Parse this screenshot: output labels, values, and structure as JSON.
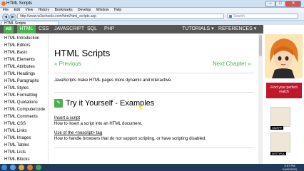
{
  "window": {
    "title": "HTML Scripts",
    "minimize": "–",
    "maximize": "□",
    "close": "✕"
  },
  "menu": [
    "File",
    "Edit",
    "View",
    "History",
    "Bookmarks",
    "Develop",
    "Window",
    "Help"
  ],
  "browser": {
    "back": "◀",
    "forward": "▶",
    "url": "http://www.w3schools.com/html/html_scripts.asp",
    "search_placeholder": "Search",
    "tab_title": "HTML Scripts"
  },
  "site_nav": {
    "logo": "w3",
    "items": [
      "HTML",
      "CSS",
      "JAVASCRIPT",
      "SQL",
      "PHP"
    ],
    "tutorials": "TUTORIALS ▾",
    "references": "REFERENCES ▾"
  },
  "sidebar": {
    "items": [
      "HTML Introduction",
      "HTML Editors",
      "HTML Basic",
      "HTML Elements",
      "HTML Attributes",
      "HTML Headings",
      "HTML Paragraphs",
      "HTML Styles",
      "HTML Formatting",
      "HTML Quotations",
      "HTML Computercode",
      "HTML Comments",
      "HTML CSS",
      "HTML Links",
      "HTML Images",
      "HTML Tables",
      "HTML Lists",
      "HTML Blocks"
    ]
  },
  "main": {
    "title": "HTML Scripts",
    "previous": "« Previous",
    "next": "Next Chapter »",
    "intro": "JavaScripts make HTML pages more dynamic and interactive.",
    "try_heading": "Try it Yourself - Examples",
    "examples": [
      {
        "link": "Insert a script",
        "desc": "How to insert a script into an HTML document."
      },
      {
        "link": "Use of the <noscript> tag",
        "desc": "How to handle browsers that do not support scripting, or have scripting disabled."
      }
    ]
  },
  "ad": {
    "button": "Find your perfect match",
    "thumb1_label": "SNIFFP",
    "thumb2_label": "WITTIFUL"
  },
  "taskbar": {
    "time": "5:57 PM",
    "date": "24/01/2015"
  }
}
